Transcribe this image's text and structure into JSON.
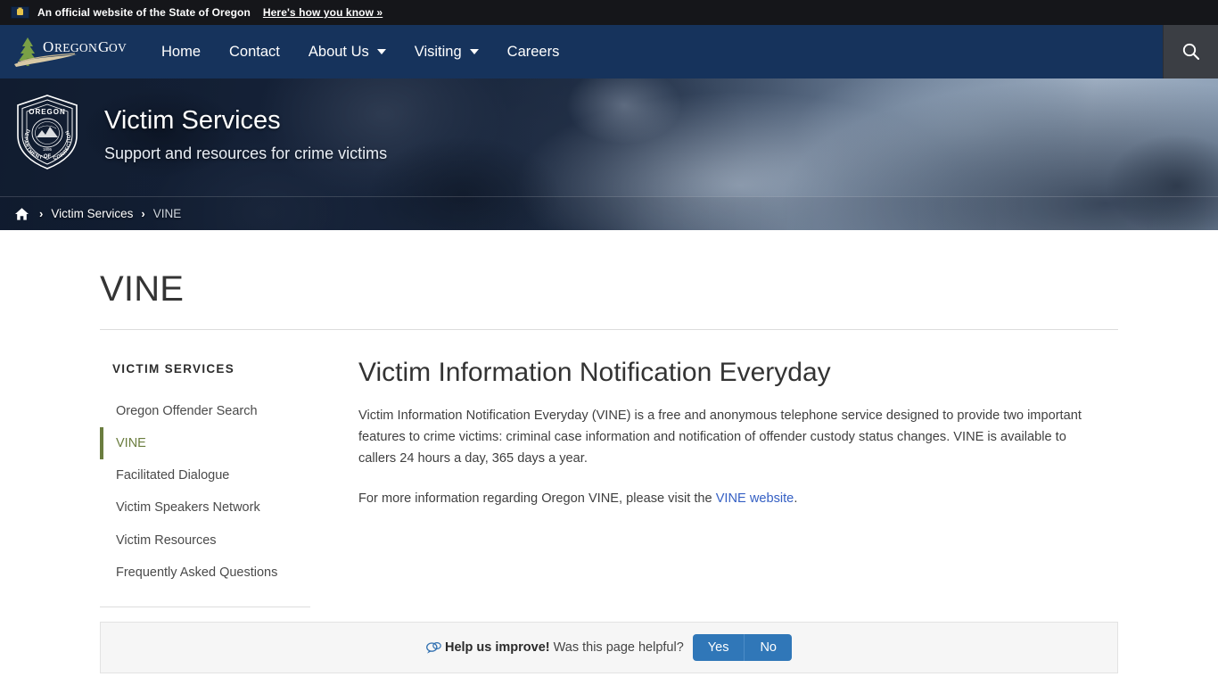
{
  "gov_banner": {
    "icon": "oregon-flag-icon",
    "text": "An official website of the State of Oregon",
    "link_label": "Here's how you know »"
  },
  "navbar": {
    "brand_label": "OREGON.GOV",
    "items": [
      {
        "label": "Home",
        "has_dropdown": false
      },
      {
        "label": "Contact",
        "has_dropdown": false
      },
      {
        "label": "About Us",
        "has_dropdown": true
      },
      {
        "label": "Visiting",
        "has_dropdown": true
      },
      {
        "label": "Careers",
        "has_dropdown": false
      }
    ],
    "search_icon": "search-icon"
  },
  "hero": {
    "seal_alt": "Oregon Department of Corrections seal",
    "title": "Victim Services",
    "subtitle": "Support and resources for crime victims"
  },
  "breadcrumb": {
    "home_icon": "home-icon",
    "separator": "›",
    "items": [
      {
        "label": "Victim Services",
        "current": false
      },
      {
        "label": "VINE",
        "current": true
      }
    ]
  },
  "page": {
    "title": "VINE"
  },
  "sidebar": {
    "heading": "VICTIM SERVICES",
    "items": [
      {
        "label": "Oregon Offender Search",
        "active": false
      },
      {
        "label": "VINE",
        "active": true
      },
      {
        "label": "Facilitated Dialogue",
        "active": false
      },
      {
        "label": "Victim Speakers Network",
        "active": false
      },
      {
        "label": "Victim Resources",
        "active": false
      },
      {
        "label": "Frequently Asked Questions",
        "active": false
      }
    ],
    "active_color": "#6b7d3f"
  },
  "content": {
    "heading": "Victim Information Notification Everyday",
    "paragraph_1": "Victim Information Notification Everyday (VINE) is a free and anonymous telephone service designed to provide two important features to crime victims: criminal case information and notification of offender custody status changes. VINE is available to callers 24 hours a day, 365 days a year.",
    "paragraph_2_before": "For more information regarding Oregon VINE, please visit the ",
    "paragraph_2_link": "VINE website",
    "paragraph_2_after": ".",
    "link_color": "#3560c4"
  },
  "feedback": {
    "icon": "speech-bubble-icon",
    "strong_text": "Help us improve!",
    "question": "Was this page helpful?",
    "yes_label": "Yes",
    "no_label": "No",
    "button_color": "#3077b8"
  }
}
